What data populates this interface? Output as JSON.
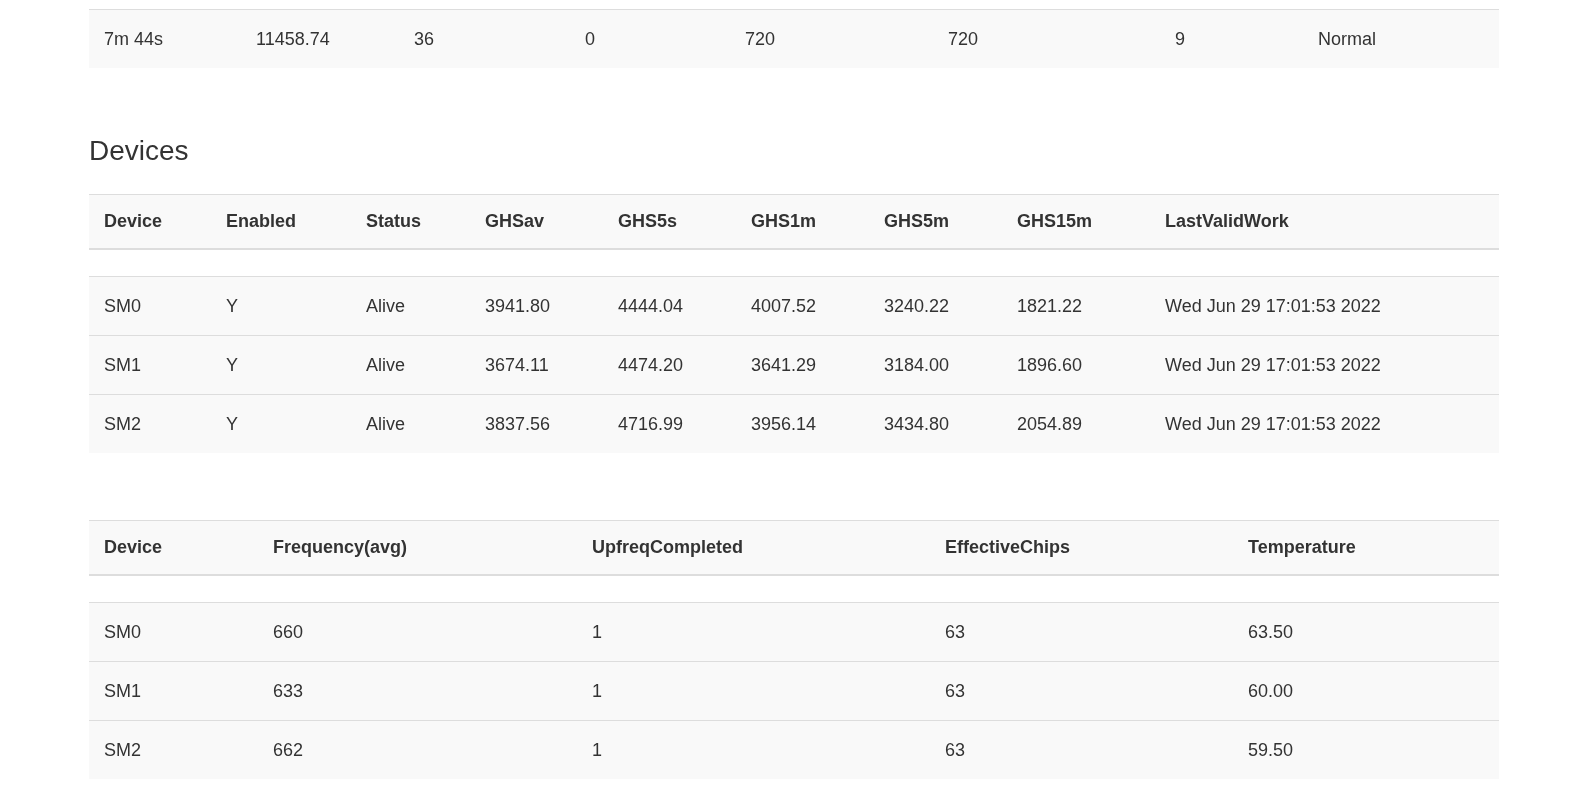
{
  "summary_table": {
    "rows": [
      [
        "7m 44s",
        "11458.74",
        "36",
        "0",
        "720",
        "720",
        "9",
        "Normal"
      ]
    ]
  },
  "devices": {
    "title": "Devices",
    "tables": [
      {
        "columns": [
          "Device",
          "Enabled",
          "Status",
          "GHSav",
          "GHS5s",
          "GHS1m",
          "GHS5m",
          "GHS15m",
          "LastValidWork"
        ],
        "rows": [
          [
            "SM0",
            "Y",
            "Alive",
            "3941.80",
            "4444.04",
            "4007.52",
            "3240.22",
            "1821.22",
            "Wed Jun 29 17:01:53 2022"
          ],
          [
            "SM1",
            "Y",
            "Alive",
            "3674.11",
            "4474.20",
            "3641.29",
            "3184.00",
            "1896.60",
            "Wed Jun 29 17:01:53 2022"
          ],
          [
            "SM2",
            "Y",
            "Alive",
            "3837.56",
            "4716.99",
            "3956.14",
            "3434.80",
            "2054.89",
            "Wed Jun 29 17:01:53 2022"
          ]
        ]
      },
      {
        "columns": [
          "Device",
          "Frequency(avg)",
          "UpfreqCompleted",
          "EffectiveChips",
          "Temperature"
        ],
        "rows": [
          [
            "SM0",
            "660",
            "1",
            "63",
            "63.50"
          ],
          [
            "SM1",
            "633",
            "1",
            "63",
            "60.00"
          ],
          [
            "SM2",
            "662",
            "1",
            "63",
            "59.50"
          ]
        ]
      }
    ]
  }
}
